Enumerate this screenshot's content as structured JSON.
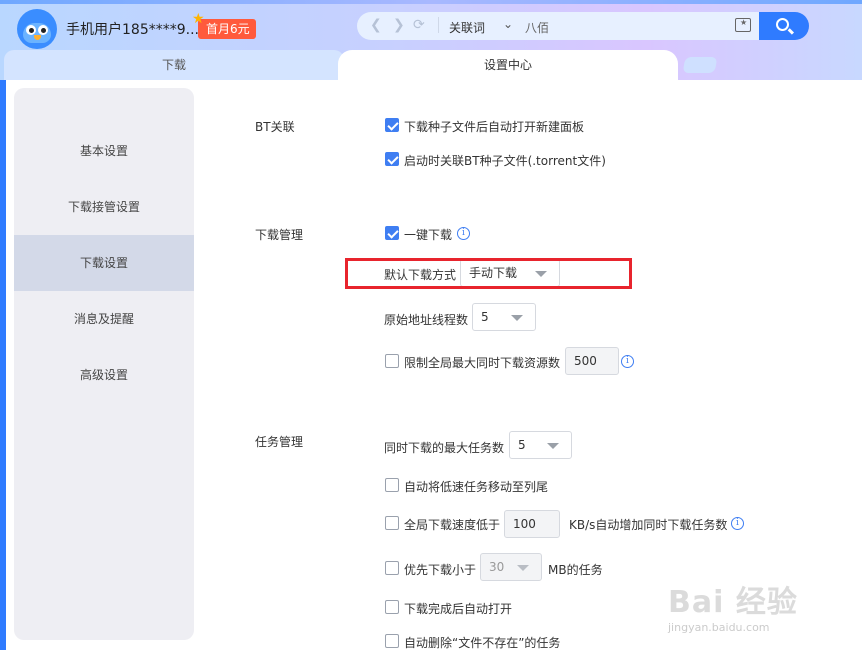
{
  "header": {
    "username": "手机用户185****9...",
    "vip_badge": "首月6元",
    "search": {
      "keyword_type": "关联词",
      "query": "八佰"
    }
  },
  "tabs": [
    {
      "label": "下载"
    },
    {
      "label": "设置中心"
    }
  ],
  "sidebar": {
    "items": [
      {
        "label": "基本设置"
      },
      {
        "label": "下载接管设置"
      },
      {
        "label": "下载设置",
        "active": true
      },
      {
        "label": "消息及提醒"
      },
      {
        "label": "高级设置"
      }
    ]
  },
  "bt": {
    "section": "BT关联",
    "open_panel": {
      "label": "下载种子文件后自动打开新建面板",
      "checked": true
    },
    "assoc_torrent": {
      "label": "启动时关联BT种子文件(.torrent文件)",
      "checked": true
    }
  },
  "download_mgmt": {
    "section": "下载管理",
    "one_click": {
      "label": "一键下载",
      "checked": true
    },
    "default_mode": {
      "label": "默认下载方式",
      "value": "手动下载"
    },
    "threads": {
      "label": "原始地址线程数",
      "value": "5"
    },
    "limit_sources": {
      "label": "限制全局最大同时下载资源数",
      "checked": false,
      "value": "500"
    }
  },
  "task_mgmt": {
    "section": "任务管理",
    "max_tasks": {
      "label": "同时下载的最大任务数",
      "value": "5"
    },
    "move_slow": {
      "label": "自动将低速任务移动至列尾",
      "checked": false
    },
    "speed_threshold": {
      "label_prefix": "全局下载速度低于",
      "value": "100",
      "label_suffix": "KB/s自动增加同时下载任务数",
      "checked": false
    },
    "priority_small": {
      "label_prefix": "优先下载小于",
      "value": "30",
      "label_suffix": "MB的任务",
      "checked": false
    },
    "auto_open": {
      "label": "下载完成后自动打开",
      "checked": false
    },
    "auto_delete": {
      "label": "自动删除“文件不存在”的任务",
      "checked": false
    }
  },
  "watermark": {
    "text": "Bai 经验",
    "url": "jingyan.baidu.com"
  },
  "colors": {
    "accent": "#2f7bff",
    "checkbox": "#3f7ef2",
    "highlight": "#e8242d"
  }
}
